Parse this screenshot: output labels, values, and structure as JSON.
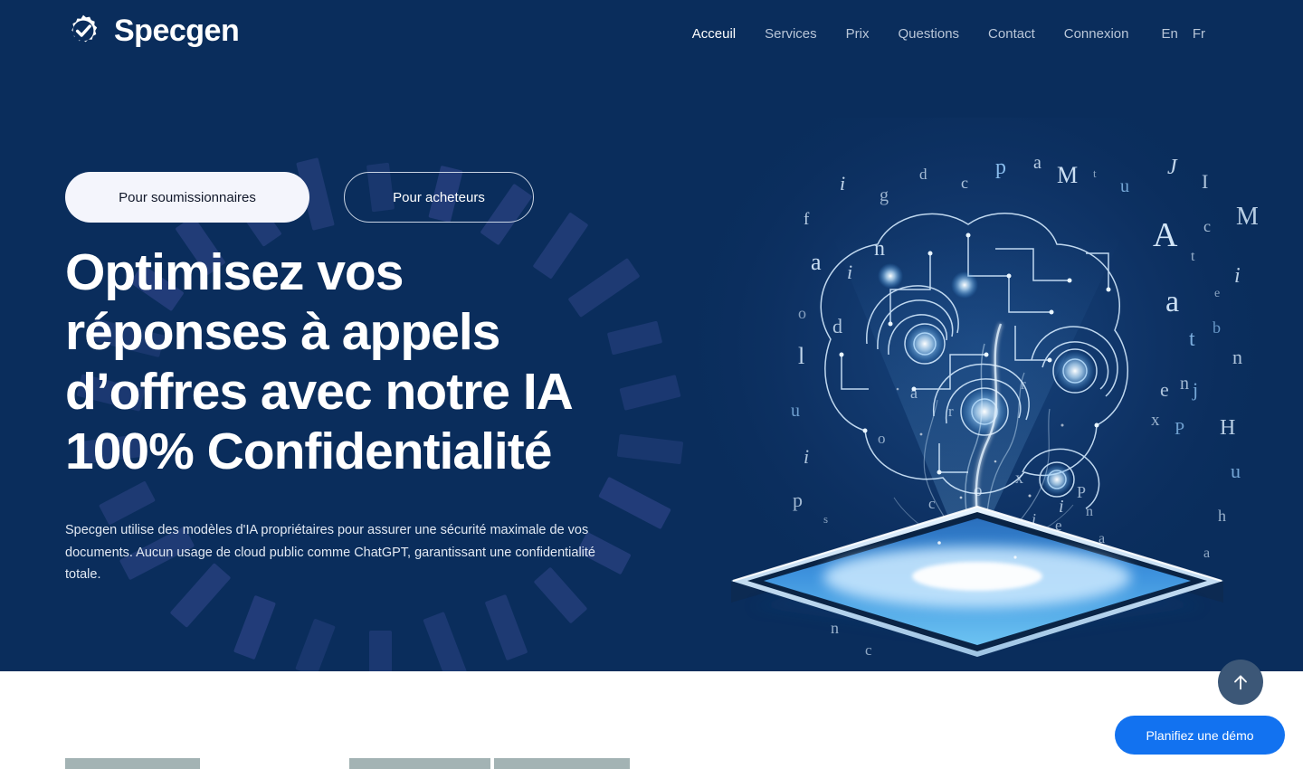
{
  "brand": {
    "name": "Specgen",
    "icon": "gear-check-icon"
  },
  "nav": {
    "items": [
      {
        "label": "Acceuil",
        "active": true
      },
      {
        "label": "Services",
        "active": false
      },
      {
        "label": "Prix",
        "active": false
      },
      {
        "label": "Questions",
        "active": false
      },
      {
        "label": "Contact",
        "active": false
      },
      {
        "label": "Connexion",
        "active": false
      }
    ],
    "languages": [
      {
        "label": "En"
      },
      {
        "label": "Fr"
      }
    ]
  },
  "hero": {
    "audience_tabs": [
      {
        "label": "Pour soumissionnaires",
        "selected": true
      },
      {
        "label": "Pour acheteurs",
        "selected": false
      }
    ],
    "headline": "Optimisez vos réponses à appels d’offres avec notre IA 100% Confidentialité",
    "subtext": "Specgen utilise des modèles d'IA propriétaires pour assurer une sécurité maximale de vos documents. Aucun usage de cloud public comme ChatGPT, garantissant une confidentialité totale.",
    "artwork": "ai-brain-tablet-illustration"
  },
  "floating": {
    "scroll_top_icon": "arrow-up-icon",
    "demo_button_label": "Planifiez une démo"
  },
  "colors": {
    "hero_background": "#0a2d5c",
    "accent_blue": "#1272f0",
    "pill_filled_bg": "#f4f5fc",
    "nav_muted": "#b9c6d8",
    "scroll_top_bg": "#3c5777",
    "deco_rect": "#27407e",
    "placeholder_block": "#a3b3b4"
  }
}
